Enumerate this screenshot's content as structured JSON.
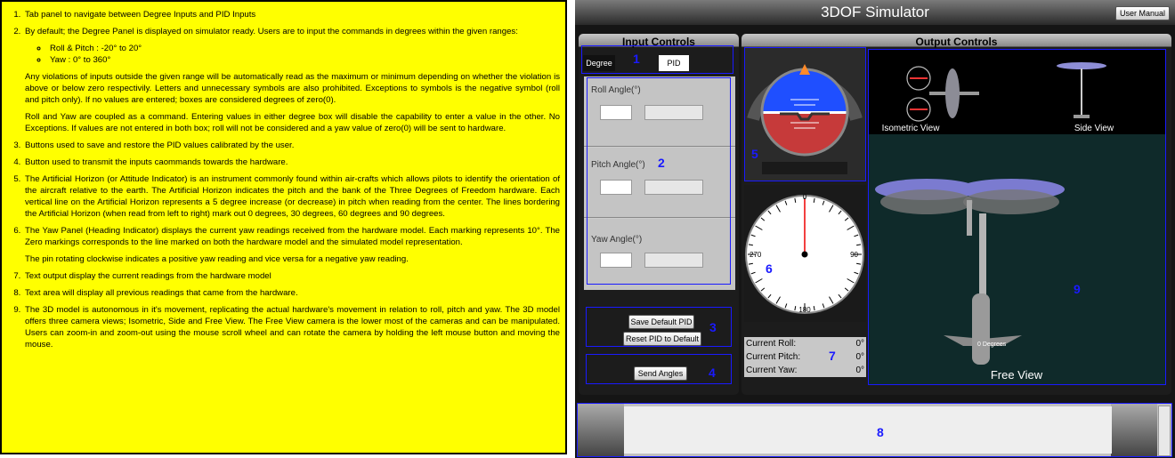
{
  "doc": {
    "item1": "Tab panel to navigate between Degree Inputs and PID Inputs",
    "item2": "By default; the Degree Panel is displayed on simulator ready. Users are to input the commands in degrees within the given ranges:",
    "item2_ranges": [
      "Roll & Pitch : -20° to 20°",
      "Yaw : 0° to 360°"
    ],
    "item2_p1": "Any violations of inputs outside the given range will be automatically read as the maximum or minimum depending on whether the violation is above or below zero respectivily. Letters and unnecessary symbols are also prohibited. Exceptions to symbols is the negative symbol (roll and pitch only). If no values are entered; boxes are considered degrees of zero(0).",
    "item2_p2": "Roll and Yaw are coupled as a command. Entering values in either degree box will disable the capability to enter a value in the other. No Exceptions. If values are not entered in both box; roll will not be considered and a yaw value of zero(0) will be sent to hardware.",
    "item3": "Buttons used to save and restore the PID values calibrated by the user.",
    "item4": "Button used to transmit the inputs caommands towards the hardware.",
    "item5": "The Artificial Horizon (or Attitude Indicator) is an instrument commonly found within air-crafts which allows pilots to identify the orientation of the aircraft relative to the earth. The Artificial Horizon indicates the pitch and the bank of the Three Degrees of Freedom hardware. Each vertical line on the Artificial Horizon represents a 5 degree increase (or decrease) in pitch when reading from the center. The lines bordering the Artificial Horizon (when read from left to right) mark out 0 degrees, 30 degrees, 60 degrees and 90 degrees.",
    "item6": "The Yaw Panel (Heading Indicator) displays the current yaw readings received from the hardware model. Each marking represents 10°. The Zero markings corresponds to the line marked on both the hardware model and the simulated model representation.",
    "item6_p": "The pin rotating clockwise indicates a positive yaw reading and vice versa for a negative yaw reading.",
    "item7": "Text output display the current readings from the hardware model",
    "item8": "Text area will display all previous readings that came from the hardware.",
    "item9": "The 3D model is autonomous in it's movement, replicating the actual hardware's movement in relation to roll, pitch and yaw. The 3D model offers three camera views; Isometric, Side and Free View. The Free View camera is the lower most of the cameras and can be manipulated. Users can zoom-in and zoom-out using the mouse scroll wheel and can rotate the camera by holding the left mouse button and moving the mouse."
  },
  "sim": {
    "title": "3DOF Simulator",
    "user_manual": "User Manual",
    "input_controls": "Input Controls",
    "output_controls": "Output Controls",
    "tab_degree": "Degree",
    "tab_pid": "PID",
    "roll_label": "Roll Angle(°)",
    "pitch_label": "Pitch Angle(°)",
    "yaw_label": "Yaw Angle(°)",
    "save_pid": "Save Default PID",
    "reset_pid": "Reset PID to Default",
    "send_angles": "Send Angles",
    "current_roll": "Current Roll:",
    "current_pitch": "Current Pitch:",
    "current_yaw": "Current Yaw:",
    "roll_value": "0°",
    "pitch_value": "0°",
    "yaw_value": "0°",
    "isometric_view": "Isometric View",
    "side_view": "Side View",
    "free_view": "Free View",
    "model_label": "0 Degrees",
    "heading_0": "0",
    "heading_90": "90",
    "heading_180": "180",
    "heading_270": "270",
    "callouts": [
      "1",
      "2",
      "3",
      "4",
      "5",
      "6",
      "7",
      "8",
      "9"
    ]
  }
}
